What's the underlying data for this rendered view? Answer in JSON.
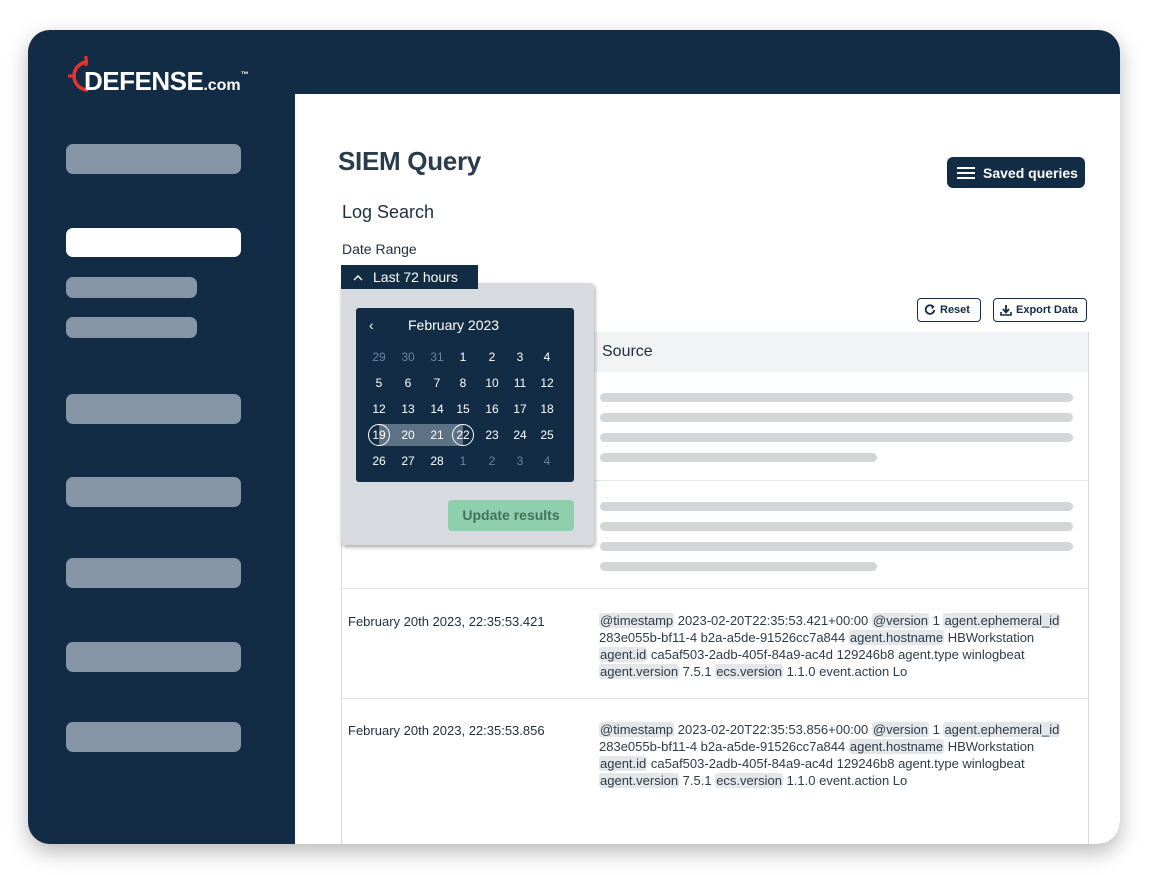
{
  "brand": {
    "name": "DEFENSE",
    "suffix": ".com",
    "tm": "™",
    "accent_color": "#e8322e",
    "frame_color": "#132c45"
  },
  "page": {
    "title": "SIEM Query",
    "section_title": "Log Search",
    "date_range_label": "Date Range",
    "saved_queries_label": "Saved queries",
    "reset_label": "Reset",
    "export_label": "Export Data"
  },
  "date_range": {
    "selected_label": "Last 72 hours",
    "update_label": "Update results",
    "calendar": {
      "prev_symbol": "‹",
      "month_label": "February 2023",
      "weeks": [
        [
          {
            "d": "29",
            "m": true
          },
          {
            "d": "30",
            "m": true
          },
          {
            "d": "31",
            "m": true
          },
          {
            "d": "1"
          },
          {
            "d": "2"
          },
          {
            "d": "3"
          },
          {
            "d": "4"
          }
        ],
        [
          {
            "d": "5"
          },
          {
            "d": "6"
          },
          {
            "d": "7"
          },
          {
            "d": "8"
          },
          {
            "d": "10"
          },
          {
            "d": "11"
          },
          {
            "d": "12"
          }
        ],
        [
          {
            "d": "12"
          },
          {
            "d": "13"
          },
          {
            "d": "14"
          },
          {
            "d": "15"
          },
          {
            "d": "16"
          },
          {
            "d": "17"
          },
          {
            "d": "18"
          }
        ],
        [
          {
            "d": "19",
            "end": true
          },
          {
            "d": "20",
            "range": true
          },
          {
            "d": "21",
            "range": true
          },
          {
            "d": "22",
            "end": true
          },
          {
            "d": "23"
          },
          {
            "d": "24"
          },
          {
            "d": "25"
          }
        ],
        [
          {
            "d": "26"
          },
          {
            "d": "27"
          },
          {
            "d": "28"
          },
          {
            "d": "1",
            "m": true
          },
          {
            "d": "2",
            "m": true
          },
          {
            "d": "3",
            "m": true
          },
          {
            "d": "4",
            "m": true
          }
        ]
      ]
    }
  },
  "table": {
    "source_header": "Source",
    "rows": [
      {
        "timestamp": "February 20th 2023, 22:35:53.421",
        "source_lines": [
          [
            {
              "t": "@timestamp",
              "k": true
            },
            {
              "t": " 2023-02-20T22:35:53.421+00:00 "
            },
            {
              "t": "@version",
              "k": true
            },
            {
              "t": " 1 "
            },
            {
              "t": "agent.ephemeral_id",
              "k": true
            }
          ],
          [
            {
              "t": "283e055b-bf11-4 b2a-a5de-91526cc7a844 "
            },
            {
              "t": "agent.hostname",
              "k": true
            },
            {
              "t": " HBWorkstation"
            }
          ],
          [
            {
              "t": "agent.id",
              "k": true
            },
            {
              "t": " ca5af503-2adb-405f-84a9-ac4d 129246b8 agent.type winlogbeat"
            }
          ],
          [
            {
              "t": "agent.version",
              "k": true
            },
            {
              "t": " 7.5.1 "
            },
            {
              "t": "ecs.version",
              "k": true
            },
            {
              "t": " 1.1.0 event.action Lo"
            }
          ]
        ]
      },
      {
        "timestamp": "February 20th 2023, 22:35:53.856",
        "source_lines": [
          [
            {
              "t": "@timestamp",
              "k": true
            },
            {
              "t": " 2023-02-20T22:35:53.856+00:00 "
            },
            {
              "t": "@version",
              "k": true
            },
            {
              "t": " 1 "
            },
            {
              "t": "agent.ephemeral_id",
              "k": true
            }
          ],
          [
            {
              "t": "283e055b-bf11-4 b2a-a5de-91526cc7a844 "
            },
            {
              "t": "agent.hostname",
              "k": true
            },
            {
              "t": " HBWorkstation"
            }
          ],
          [
            {
              "t": "agent.id",
              "k": true
            },
            {
              "t": " ca5af503-2adb-405f-84a9-ac4d 129246b8 agent.type winlogbeat"
            }
          ],
          [
            {
              "t": "agent.version",
              "k": true
            },
            {
              "t": " 7.5.1 "
            },
            {
              "t": "ecs.version",
              "k": true
            },
            {
              "t": " 1.1.0 event.action Lo"
            }
          ]
        ]
      }
    ]
  }
}
